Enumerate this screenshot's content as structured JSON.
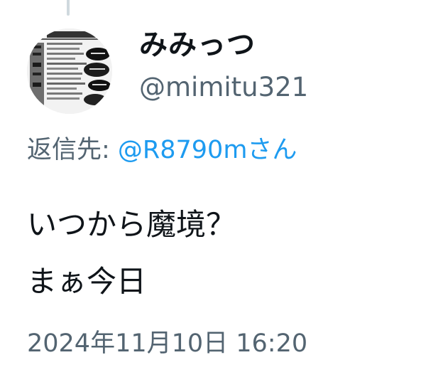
{
  "tweet": {
    "author": {
      "display_name": "みみっつ",
      "handle": "@mimitu321",
      "avatar_icon": "document-collage-avatar"
    },
    "reply_prefix": "返信先: ",
    "reply_mention": "@R8790mさん",
    "text_lines": [
      "いつから魔境？",
      "まぁ今日"
    ],
    "timestamp": "2024年11月10日 16:20"
  },
  "colors": {
    "text_primary": "#0f1419",
    "text_secondary": "#536471",
    "link": "#1d9bf0",
    "thread_line": "#cfd9de"
  }
}
